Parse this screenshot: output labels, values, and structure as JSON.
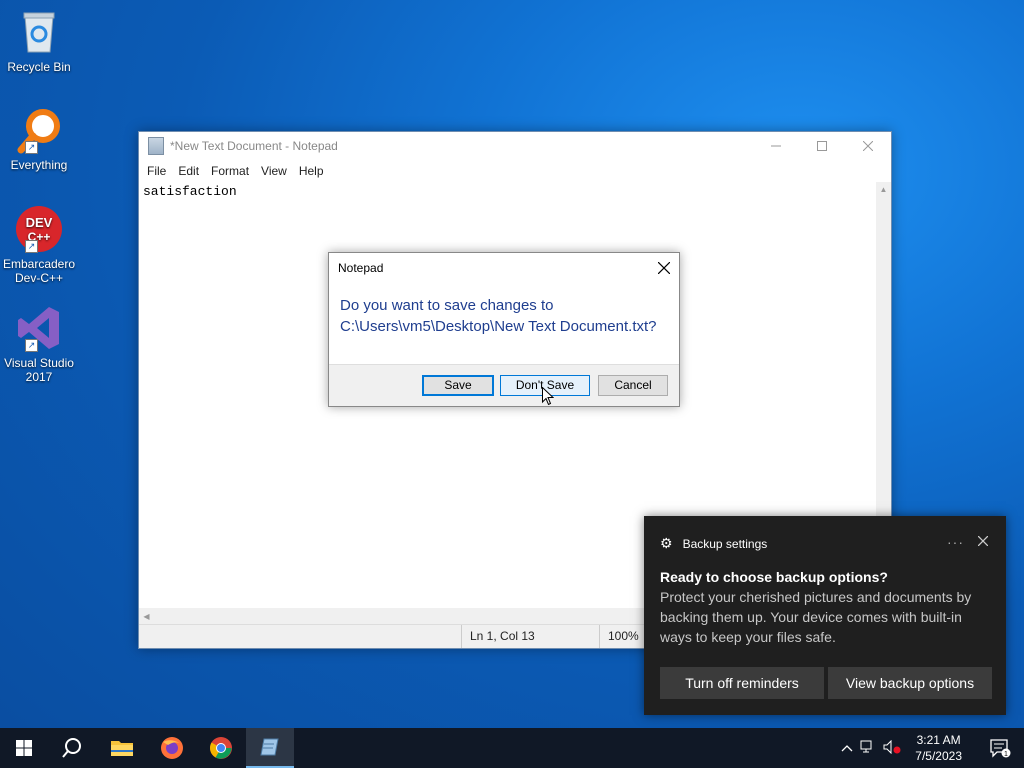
{
  "desktop": {
    "icons": [
      {
        "label": "Recycle Bin",
        "icon": "recycle-bin-icon"
      },
      {
        "label": "Everything",
        "icon": "everything-search-icon"
      },
      {
        "label": "Embarcadero Dev-C++",
        "icon": "devcpp-icon",
        "badge": "DEV C++"
      },
      {
        "label": "Visual Studio 2017",
        "icon": "visual-studio-icon"
      }
    ]
  },
  "notepad": {
    "title": "*New Text Document - Notepad",
    "menu": [
      "File",
      "Edit",
      "Format",
      "View",
      "Help"
    ],
    "content": "satisfaction",
    "status": {
      "position": "Ln 1, Col 13",
      "zoom": "100%"
    }
  },
  "dialog": {
    "title": "Notepad",
    "message_line1": "Do you want to save changes to",
    "message_line2": "C:\\Users\\vm5\\Desktop\\New Text Document.txt?",
    "buttons": {
      "save": "Save",
      "dont_save": "Don't Save",
      "cancel": "Cancel"
    }
  },
  "toast": {
    "app": "Backup settings",
    "more": "···",
    "title": "Ready to choose backup options?",
    "body": "Protect your cherished pictures and documents by backing them up. Your device comes with built-in ways to keep your files safe.",
    "buttons": {
      "turn_off": "Turn off reminders",
      "view": "View backup options"
    }
  },
  "taskbar": {
    "apps": [
      "start",
      "search",
      "file-explorer",
      "firefox",
      "chrome",
      "notepad"
    ],
    "active": "notepad",
    "clock": {
      "time": "3:21 AM",
      "date": "7/5/2023"
    },
    "notification_count": "1"
  }
}
